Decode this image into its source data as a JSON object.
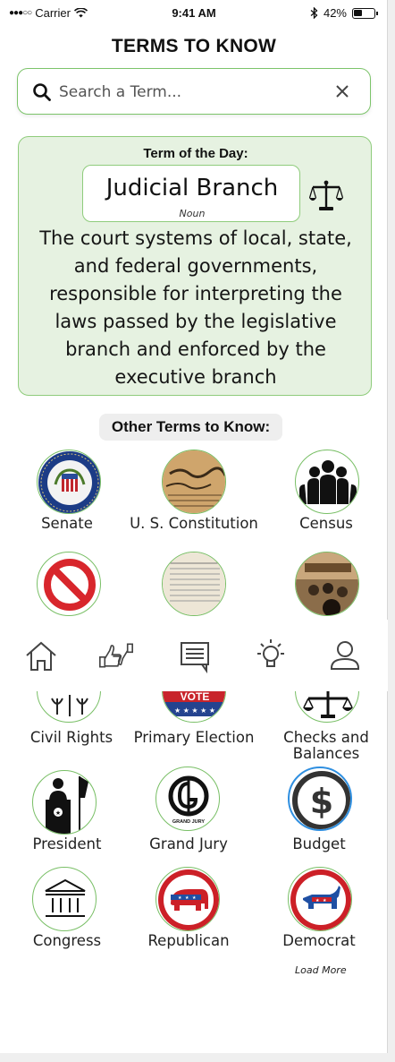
{
  "status_bar": {
    "carrier": "Carrier",
    "time": "9:41 AM",
    "battery": "42%"
  },
  "header": {
    "title": "TERMS TO KNOW"
  },
  "search": {
    "placeholder": "Search a Term..."
  },
  "term_of_day": {
    "label": "Term of the Day:",
    "term": "Judicial Branch",
    "part_of_speech": "Noun",
    "definition": "The court systems of local, state, and federal governments, responsible for interpreting the laws passed by the legislative branch and enforced by the executive branch",
    "icon": "scale-icon"
  },
  "other_terms": {
    "heading": "Other Terms to Know:",
    "row1": [
      {
        "label": "Senate",
        "icon": "senate-seal-icon"
      },
      {
        "label": "U. S. Constitution",
        "icon": "constitution-icon"
      },
      {
        "label": "Census",
        "icon": "people-icon"
      }
    ],
    "row2": [
      {
        "label": "",
        "icon": "prohibited-icon"
      },
      {
        "label": "",
        "icon": "document-icon"
      },
      {
        "label": "",
        "icon": "courtroom-icon"
      }
    ],
    "row3": [
      {
        "label": "Civil Rights",
        "icon": "civil-rights-icon"
      },
      {
        "label": "Primary Election",
        "icon": "vote-badge-icon"
      },
      {
        "label": "Checks and Balances",
        "icon": "balance-icon"
      }
    ],
    "row4": [
      {
        "label": "President",
        "icon": "podium-icon"
      },
      {
        "label": "Grand Jury",
        "icon": "grand-jury-icon"
      },
      {
        "label": "Budget",
        "icon": "dollar-icon"
      }
    ],
    "row5": [
      {
        "label": "Congress",
        "icon": "capitol-building-icon"
      },
      {
        "label": "Republican",
        "icon": "elephant-icon"
      },
      {
        "label": "Democrat",
        "icon": "donkey-icon"
      }
    ],
    "load_more": "Load More",
    "grand_jury_badge": "GRAND JURY",
    "vote_badge": "VOTE"
  },
  "tabs": [
    {
      "name": "home",
      "icon": "home-icon"
    },
    {
      "name": "vote",
      "icon": "thumbs-icon"
    },
    {
      "name": "messages",
      "icon": "chat-icon"
    },
    {
      "name": "ideas",
      "icon": "lightbulb-icon"
    },
    {
      "name": "profile",
      "icon": "user-icon"
    }
  ],
  "colors": {
    "accent_green": "#7cc46a",
    "card_green_bg": "#e6f2e1",
    "budget_blue": "#2f8fe0",
    "republican_red": "#cc2027",
    "democrat_blue": "#1f4fa3"
  }
}
